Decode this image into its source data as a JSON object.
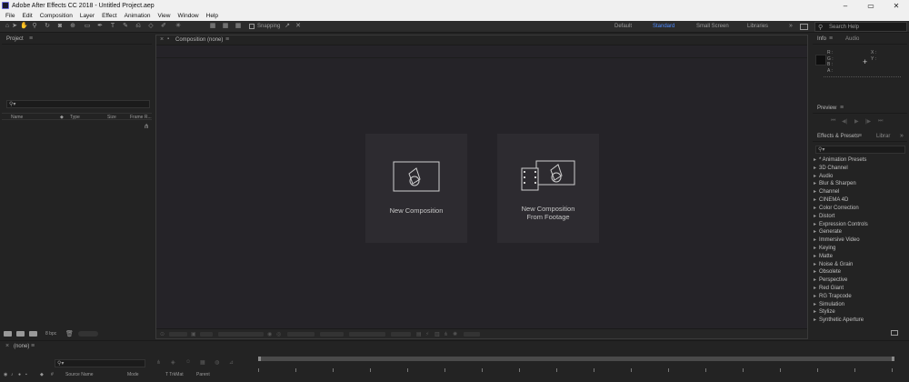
{
  "window": {
    "title": "Adobe After Effects CC 2018 - Untitled Project.aep",
    "controls": {
      "minimize": "–",
      "maximize": "▭",
      "close": "✕"
    }
  },
  "menu": [
    "File",
    "Edit",
    "Composition",
    "Layer",
    "Effect",
    "Animation",
    "View",
    "Window",
    "Help"
  ],
  "toolbar": {
    "snapping_label": "Snapping",
    "workspaces": [
      "Default",
      "Standard",
      "Small Screen",
      "Libraries"
    ],
    "active_workspace": "Standard",
    "overflow_icon": "»",
    "search_help_placeholder": "Search Help"
  },
  "project_panel": {
    "title": "Project",
    "columns": [
      "Name",
      "Type",
      "Size",
      "Frame R..."
    ],
    "footer_bpc": "8 bpc"
  },
  "composition_panel": {
    "title": "Composition (none)",
    "cards": [
      {
        "label_line1": "New Composition",
        "label_line2": ""
      },
      {
        "label_line1": "New Composition",
        "label_line2": "From Footage"
      }
    ]
  },
  "info_panel": {
    "tabs": [
      "Info",
      "Audio"
    ],
    "rgba": [
      "R :",
      "G :",
      "B :",
      "A :"
    ],
    "xy": [
      "X :",
      "Y :"
    ]
  },
  "preview_panel": {
    "title": "Preview"
  },
  "effects_panel": {
    "tabs": [
      "Effects & Presets",
      "Librar"
    ],
    "items": [
      "* Animation Presets",
      "3D Channel",
      "Audio",
      "Blur & Sharpen",
      "Channel",
      "CINEMA 4D",
      "Color Correction",
      "Distort",
      "Expression Controls",
      "Generate",
      "Immersive Video",
      "Keying",
      "Matte",
      "Noise & Grain",
      "Obsolete",
      "Perspective",
      "Red Giant",
      "RG Trapcode",
      "Simulation",
      "Stylize",
      "Synthetic Aperture"
    ]
  },
  "timeline": {
    "title": "(none)",
    "columns": [
      "#",
      "Source Name",
      "Mode",
      "T TrkMat",
      "Parent"
    ]
  },
  "colors": {
    "accent": "#4f8cff",
    "panel_bg": "#232323",
    "comp_bg": "#252328",
    "card_bg": "#2d2b30"
  }
}
